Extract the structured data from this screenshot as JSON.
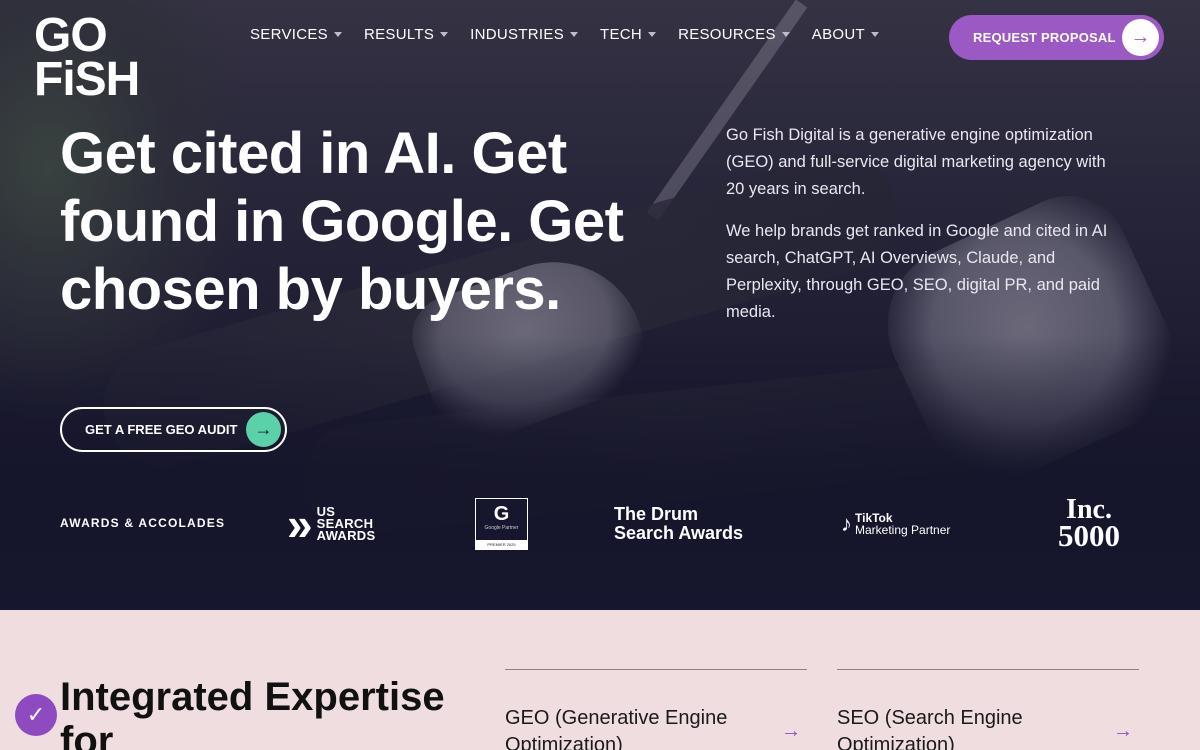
{
  "brand": {
    "logo_line1": "GO",
    "logo_line2": "FiSH"
  },
  "nav": {
    "items": [
      {
        "label": "SERVICES"
      },
      {
        "label": "RESULTS"
      },
      {
        "label": "INDUSTRIES"
      },
      {
        "label": "TECH"
      },
      {
        "label": "RESOURCES"
      },
      {
        "label": "ABOUT"
      }
    ],
    "cta_label": "REQUEST PROPOSAL"
  },
  "hero": {
    "headline": "Get cited in AI. Get found in Google. Get chosen by buyers.",
    "intro_p1": "Go Fish Digital is a generative engine optimization (GEO) and full-service digital marketing agency with 20 years in search.",
    "intro_p2": "We help brands get ranked in Google and cited in AI search, ChatGPT, AI Overviews, Claude, and Perplexity, through GEO, SEO, digital PR, and paid media.",
    "cta_label": "GET A FREE GEO AUDIT"
  },
  "awards": {
    "label": "AWARDS & ACCOLADES",
    "us_search_line1": "US",
    "us_search_line2": "SEARCH",
    "us_search_line3": "AWARDS",
    "google_g": "G",
    "google_partner": "Google Partner",
    "google_premier": "PREMIER 2025",
    "drum_line1": "The Drum",
    "drum_line2": "Search Awards",
    "tiktok_line1": "TikTok",
    "tiktok_line2": "Marketing Partner",
    "inc_line1": "Inc.",
    "inc_line2": "5000"
  },
  "expertise": {
    "title": "Integrated Expertise for",
    "services": [
      {
        "label": "GEO (Generative Engine Optimization)"
      },
      {
        "label": "SEO (Search Engine Optimization)"
      }
    ]
  },
  "colors": {
    "accent_purple": "#9b59c4",
    "accent_green": "#5bd1a9",
    "hero_dark": "#16162e",
    "section_bg": "#f0dde0"
  }
}
